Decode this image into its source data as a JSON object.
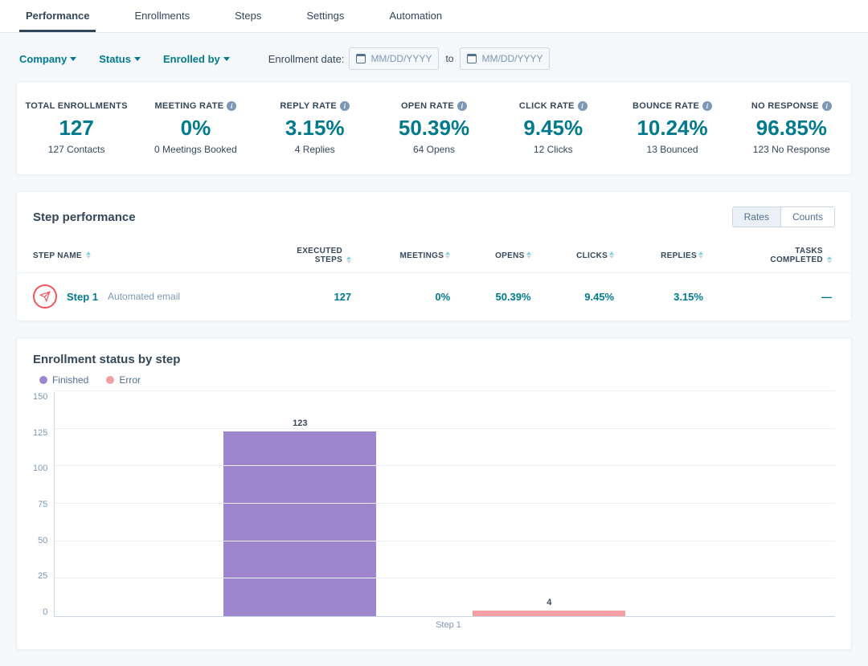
{
  "tabs": {
    "performance": "Performance",
    "enrollments": "Enrollments",
    "steps": "Steps",
    "settings": "Settings",
    "automation": "Automation"
  },
  "filters": {
    "company": "Company",
    "status": "Status",
    "enrolled_by": "Enrolled by",
    "enrollment_date_label": "Enrollment date:",
    "date_placeholder": "MM/DD/YYYY",
    "range_separator": "to"
  },
  "metrics": [
    {
      "label": "TOTAL ENROLLMENTS",
      "value": "127",
      "sub": "127 Contacts",
      "info": false
    },
    {
      "label": "MEETING RATE",
      "value": "0%",
      "sub": "0 Meetings Booked",
      "info": true
    },
    {
      "label": "REPLY RATE",
      "value": "3.15%",
      "sub": "4 Replies",
      "info": true
    },
    {
      "label": "OPEN RATE",
      "value": "50.39%",
      "sub": "64 Opens",
      "info": true
    },
    {
      "label": "CLICK RATE",
      "value": "9.45%",
      "sub": "12 Clicks",
      "info": true
    },
    {
      "label": "BOUNCE RATE",
      "value": "10.24%",
      "sub": "13 Bounced",
      "info": true
    },
    {
      "label": "NO RESPONSE",
      "value": "96.85%",
      "sub": "123 No Response",
      "info": true
    }
  ],
  "step_perf": {
    "title": "Step performance",
    "toggle": {
      "rates": "Rates",
      "counts": "Counts"
    },
    "columns": {
      "step_name": "STEP NAME",
      "executed_steps": "EXECUTED STEPS",
      "meetings": "MEETINGS",
      "opens": "OPENS",
      "clicks": "CLICKS",
      "replies": "REPLIES",
      "tasks_completed": "TASKS COMPLETED"
    },
    "rows": [
      {
        "name": "Step 1",
        "type": "Automated email",
        "executed": "127",
        "meetings": "0%",
        "opens": "50.39%",
        "clicks": "9.45%",
        "replies": "3.15%",
        "tasks": "—"
      }
    ]
  },
  "enroll_chart": {
    "title": "Enrollment status by step",
    "legend": {
      "finished": "Finished",
      "error": "Error"
    },
    "x_category": "Step 1"
  },
  "chart_data": {
    "type": "bar",
    "title": "Enrollment status by step",
    "categories": [
      "Step 1"
    ],
    "series": [
      {
        "name": "Finished",
        "values": [
          123
        ],
        "color": "#9e86cf"
      },
      {
        "name": "Error",
        "values": [
          4
        ],
        "color": "#f2a0a3"
      }
    ],
    "ylim": [
      0,
      150
    ],
    "yticks": [
      0,
      25,
      50,
      75,
      100,
      125,
      150
    ],
    "xlabel": "",
    "ylabel": ""
  }
}
